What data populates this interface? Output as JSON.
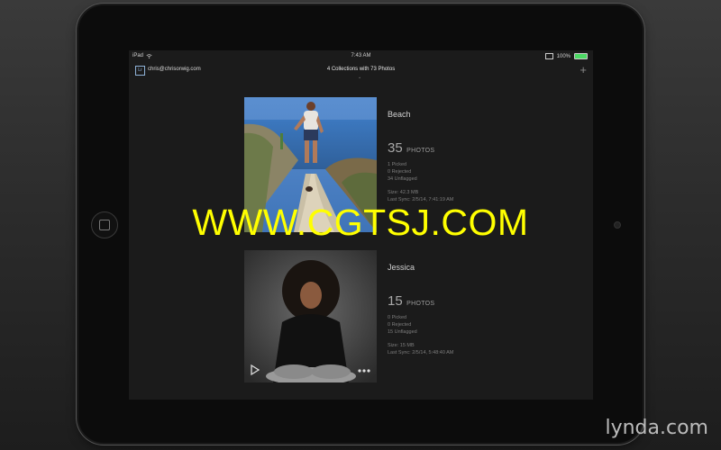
{
  "status_bar": {
    "device": "iPad",
    "time": "7:43 AM",
    "battery": "100%",
    "battery_level": 1.0
  },
  "nav": {
    "account": "chris@chrisorwig.com",
    "lr_badge": "Lr",
    "title": "4 Collections with 73 Photos",
    "chevron": "⌄",
    "add_label": "+"
  },
  "collections": [
    {
      "name": "Beach",
      "photo_count": "35",
      "photos_label": "PHOTOS",
      "picked": "1 Picked",
      "rejected": "0 Rejected",
      "unflagged": "34 Unflagged",
      "size": "Size: 42.3 MB",
      "last_sync": "Last Sync: 2/5/14, 7:41:19 AM"
    },
    {
      "name": "Jessica",
      "photo_count": "15",
      "photos_label": "PHOTOS",
      "picked": "0 Picked",
      "rejected": "0 Rejected",
      "unflagged": "15 Unflagged",
      "size": "Size: 15 MB",
      "last_sync": "Last Sync: 2/5/14, 5:48:40 AM"
    }
  ],
  "watermark": "WWW.CGTSJ.COM",
  "brand": {
    "name": "lynda",
    "dot": ".",
    "suffix": "com"
  },
  "icons": [
    "wifi-icon",
    "screen-mirror-icon",
    "battery-icon",
    "lr-badge-icon",
    "add-icon",
    "play-icon",
    "more-icon"
  ]
}
